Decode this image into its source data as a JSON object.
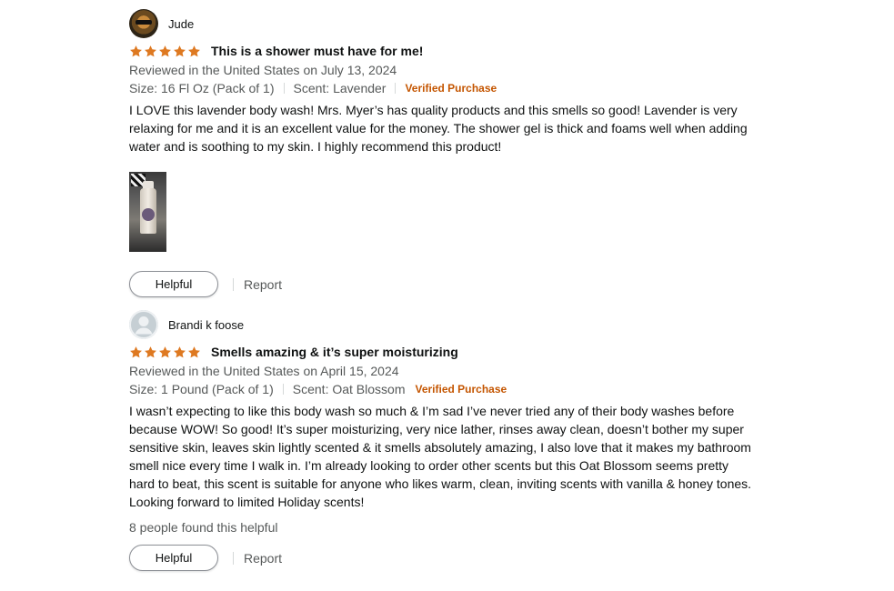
{
  "reviews": [
    {
      "reviewer": "Jude",
      "avatar": "reviewer-photo",
      "rating": 5,
      "title": "This is a shower must have for me!",
      "date": "Reviewed in the United States on July 13, 2024",
      "size": "Size: 16 Fl Oz (Pack of 1)",
      "scent": "Scent: Lavender",
      "verified": "Verified Purchase",
      "body": "I LOVE this lavender body wash! Mrs. Myer’s has quality products and this smells so good! Lavender is very relaxing for me and it is an excellent value for the money. The shower gel is thick and foams well when adding water and is soothing to my skin. I highly recommend this product!",
      "has_image": true,
      "helpful_label": "Helpful",
      "report_label": "Report"
    },
    {
      "reviewer": "Brandi k foose",
      "avatar": "default-user-icon",
      "rating": 5,
      "title": "Smells amazing & it’s super moisturizing",
      "date": "Reviewed in the United States on April 15, 2024",
      "size": "Size: 1 Pound (Pack of 1)",
      "scent": "Scent: Oat Blossom",
      "verified": "Verified Purchase",
      "body": "I wasn’t expecting to like this body wash so much & I’m sad I’ve never tried any of their body washes before because WOW! So good! It’s super moisturizing, very nice lather, rinses away clean, doesn’t bother my super sensitive skin, leaves skin lightly scented & it smells absolutely amazing, I also love that it makes my bathroom smell nice every time I walk in. I’m already looking to order other scents but this Oat Blossom seems pretty hard to beat, this scent is suitable for anyone who likes warm, clean, inviting scents with vanilla & honey tones. Looking forward to limited Holiday scents!",
      "helpful_count": "8 people found this helpful",
      "helpful_label": "Helpful",
      "report_label": "Report"
    }
  ],
  "colors": {
    "star": "#de7921",
    "verified": "#c45500",
    "secondary_text": "#565959"
  }
}
